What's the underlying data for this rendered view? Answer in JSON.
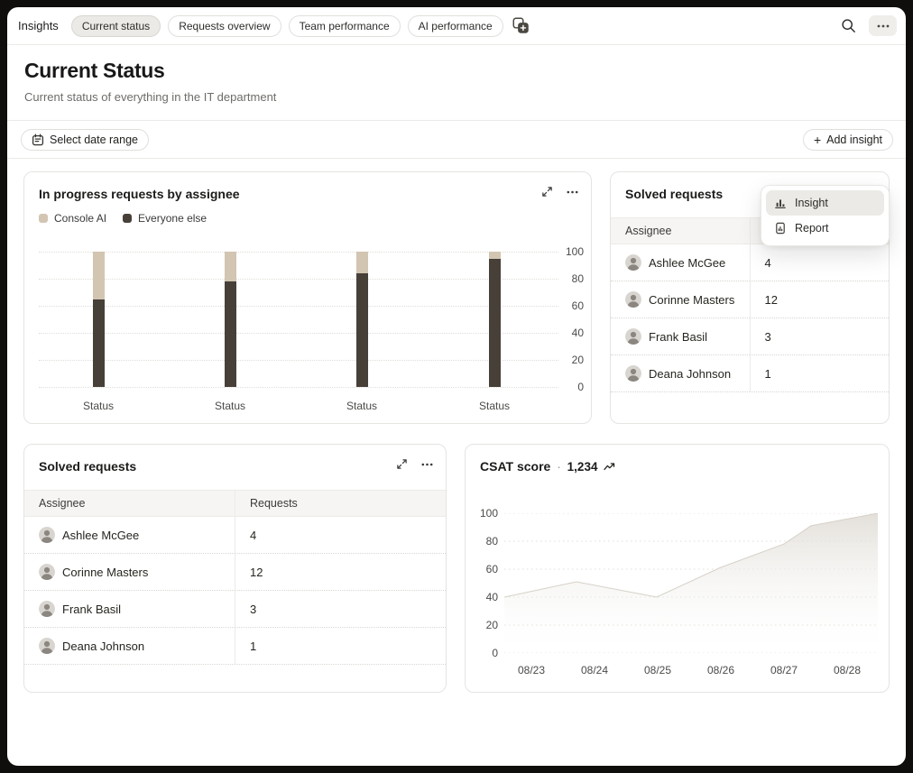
{
  "nav": {
    "label": "Insights",
    "tabs": [
      {
        "label": "Current status",
        "selected": true
      },
      {
        "label": "Requests overview",
        "selected": false
      },
      {
        "label": "Team performance",
        "selected": false
      },
      {
        "label": "AI performance",
        "selected": false
      }
    ]
  },
  "header": {
    "title": "Current Status",
    "subtitle": "Current status of everything in the IT department"
  },
  "toolbar": {
    "date_range_label": "Select date range",
    "add_insight_plus": "+",
    "add_insight_label": "Add insight"
  },
  "menu": {
    "items": [
      {
        "label": "Insight",
        "icon": "insight-bar-chart-icon",
        "highlighted": true
      },
      {
        "label": "Report",
        "icon": "report-document-icon",
        "highlighted": false
      }
    ]
  },
  "solved_requests": {
    "title": "Solved requests",
    "columns": [
      "Assignee",
      "Requests"
    ],
    "rows": [
      {
        "name": "Ashlee McGee",
        "value": "4"
      },
      {
        "name": "Corinne Masters",
        "value": "12"
      },
      {
        "name": "Frank Basil",
        "value": "3"
      },
      {
        "name": "Deana Johnson",
        "value": "1"
      }
    ]
  },
  "csat_header": {
    "title": "CSAT score",
    "separator": "·",
    "value": "1,234"
  },
  "chart_data": [
    {
      "type": "bar",
      "title": "In progress requests by assignee",
      "stacked": true,
      "categories": [
        "Status",
        "Status",
        "Status",
        "Status"
      ],
      "series": [
        {
          "name": "Everyone else",
          "color": "#474039",
          "values": [
            65,
            78,
            84,
            95
          ]
        },
        {
          "name": "Console AI",
          "color": "#d2c5b2",
          "values": [
            35,
            22,
            16,
            5
          ]
        }
      ],
      "legend": [
        {
          "label": "Console AI",
          "color": "#d2c5b2"
        },
        {
          "label": "Everyone else",
          "color": "#474039"
        }
      ],
      "ylim": [
        0,
        100
      ],
      "yticks": [
        0,
        20,
        40,
        60,
        80,
        100
      ],
      "y_axis_side": "right",
      "grid": "dotted-horizontal",
      "xlabel": "",
      "ylabel": ""
    },
    {
      "type": "area",
      "title": "CSAT score",
      "kpi_value": "1,234",
      "x_tick_labels": [
        "08/23",
        "08/24",
        "08/25",
        "08/26",
        "08/27",
        "08/28"
      ],
      "points": [
        {
          "x": 0.0,
          "value": 40
        },
        {
          "x": 0.193,
          "value": 51
        },
        {
          "x": 0.408,
          "value": 40
        },
        {
          "x": 0.577,
          "value": 61
        },
        {
          "x": 0.749,
          "value": 78
        },
        {
          "x": 0.821,
          "value": 91
        },
        {
          "x": 1.0,
          "value": 100
        }
      ],
      "ylim": [
        0,
        100
      ],
      "yticks": [
        0,
        20,
        40,
        60,
        80,
        100
      ],
      "y_axis_side": "left",
      "grid": "dotted-horizontal",
      "fill_top_color": "#dedad3",
      "fill_bottom_color": "#ffffff"
    }
  ]
}
